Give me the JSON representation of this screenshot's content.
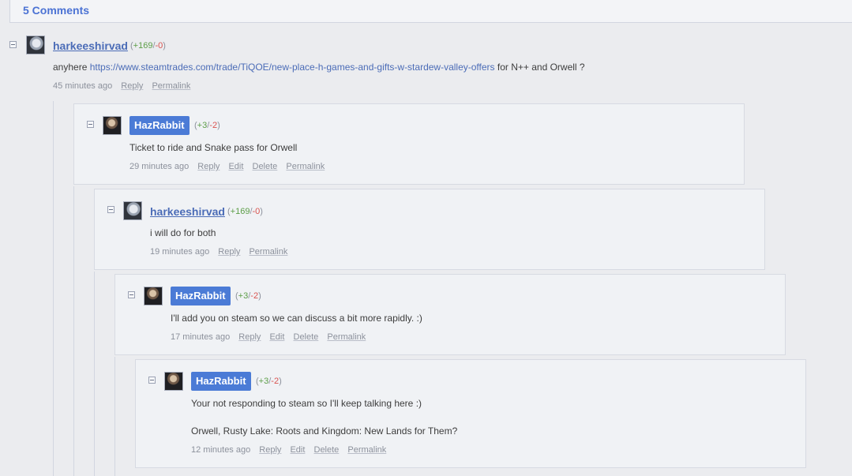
{
  "header": {
    "title": "5 Comments"
  },
  "action_labels": {
    "reply": "Reply",
    "edit": "Edit",
    "delete": "Delete",
    "permalink": "Permalink"
  },
  "comments": [
    {
      "username": "harkeeshirvad",
      "rep_open": "(",
      "rep_pos": "+169",
      "rep_sep": "/",
      "rep_neg": "-0",
      "rep_close": ")",
      "text_before": "anyhere ",
      "link": "https://www.steamtrades.com/trade/TiQOE/new-place-h-games-and-gifts-w-stardew-valley-offers",
      "text_after": " for N++ and Orwell ?",
      "time": "45 minutes ago"
    },
    {
      "username": "HazRabbit",
      "rep_open": "(",
      "rep_pos": "+3",
      "rep_sep": "/",
      "rep_neg": "-2",
      "rep_close": ")",
      "text": "Ticket to ride and Snake pass for Orwell",
      "time": "29 minutes ago"
    },
    {
      "username": "harkeeshirvad",
      "rep_open": "(",
      "rep_pos": "+169",
      "rep_sep": "/",
      "rep_neg": "-0",
      "rep_close": ")",
      "text": "i will do for both",
      "time": "19 minutes ago"
    },
    {
      "username": "HazRabbit",
      "rep_open": "(",
      "rep_pos": "+3",
      "rep_sep": "/",
      "rep_neg": "-2",
      "rep_close": ")",
      "text": "I'll add you on steam so we can discuss a bit more rapidly. :)",
      "time": "17 minutes ago"
    },
    {
      "username": "HazRabbit",
      "rep_open": "(",
      "rep_pos": "+3",
      "rep_sep": "/",
      "rep_neg": "-2",
      "rep_close": ")",
      "text": "Your not responding to steam so I'll keep talking here :)",
      "text2": "Orwell, Rusty Lake: Roots and Kingdom: New Lands for Them?",
      "time": "12 minutes ago"
    }
  ]
}
